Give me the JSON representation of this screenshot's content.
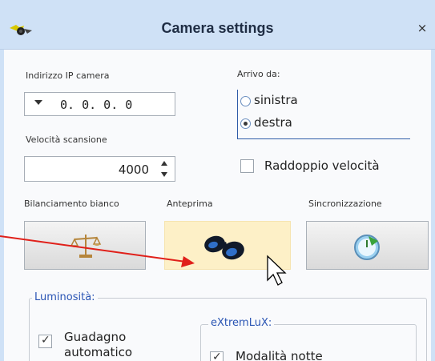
{
  "window": {
    "title": "Camera settings",
    "close_glyph": "×",
    "app_icon": "camera-app-icon"
  },
  "ip": {
    "label": "Indirizzo IP camera",
    "value": "0. 0. 0. 0"
  },
  "speed": {
    "label": "Velocità scansione",
    "value": "4000"
  },
  "arrivo": {
    "label": "Arrivo da:",
    "options": [
      "sinistra",
      "destra"
    ],
    "selected": "destra"
  },
  "raddoppio": {
    "label": "Raddoppio velocità",
    "checked": false
  },
  "buttons": {
    "bianco_label": "Bilanciamento bianco",
    "bianco_icon": "balance-scale-icon",
    "anteprima_label": "Anteprima",
    "anteprima_icon": "binoculars-icon",
    "sync_label": "Sincronizzazione",
    "sync_icon": "clock-sync-icon"
  },
  "luminosita": {
    "label": "Luminosità:",
    "guadagno_line1": "Guadagno",
    "guadagno_line2": "automatico",
    "guadagno_checked": true
  },
  "extremlux": {
    "label": "eXtremLuX:",
    "modalita_label": "Modalità notte",
    "modalita_checked": true
  },
  "overlay": {
    "arrow_color": "#e0201a",
    "cursor": "mouse-pointer-icon"
  },
  "colors": {
    "titlebar": "#cfe1f6",
    "accent_blue": "#2a55b4",
    "highlight": "#fdf0c7"
  }
}
